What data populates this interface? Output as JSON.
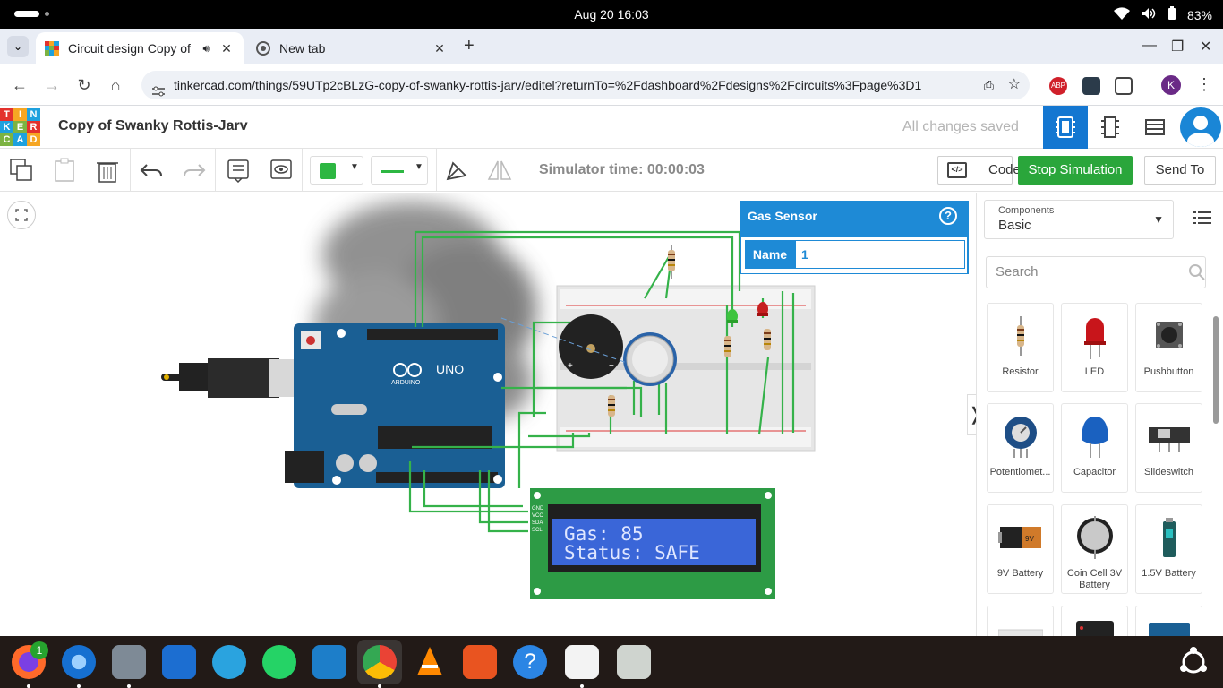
{
  "system": {
    "clock": "Aug 20  16:03",
    "battery": "83%"
  },
  "browser": {
    "tabs": [
      {
        "title": "Circuit design Copy of"
      },
      {
        "title": "New tab"
      }
    ],
    "url": "tinkercad.com/things/59UTp2cBLzG-copy-of-swanky-rottis-jarv/editel?returnTo=%2Fdashboard%2Fdesigns%2Fcircuits%3Fpage%3D1",
    "profile_initial": "K"
  },
  "app": {
    "logo_letters": [
      "T",
      "I",
      "N",
      "K",
      "E",
      "R",
      "C",
      "A",
      "D"
    ],
    "title": "Copy of Swanky Rottis-Jarv",
    "save_status": "All changes saved"
  },
  "toolbar": {
    "simulator_time": "Simulator time: 00:00:03",
    "code_label": "Code",
    "stop_label": "Stop Simulation",
    "send_label": "Send To",
    "color": "#2db742"
  },
  "inspector": {
    "title": "Gas Sensor",
    "help": "?",
    "name_label": "Name",
    "name_value": "1"
  },
  "circuit": {
    "arduino_label": "UNO",
    "arduino_brand": "ARDUINO",
    "lcd_line1": "Gas: 85",
    "lcd_line2": "Status: SAFE",
    "lcd_pins": [
      "GND",
      "VCC",
      "SDA",
      "SCL"
    ]
  },
  "components_panel": {
    "category_label": "Components",
    "category_value": "Basic",
    "search_placeholder": "Search",
    "items": [
      {
        "label": "Resistor",
        "icon": "resistor-icon"
      },
      {
        "label": "LED",
        "icon": "led-icon"
      },
      {
        "label": "Pushbutton",
        "icon": "pushbutton-icon"
      },
      {
        "label": "Potentiomet...",
        "icon": "potentiometer-icon"
      },
      {
        "label": "Capacitor",
        "icon": "capacitor-icon"
      },
      {
        "label": "Slideswitch",
        "icon": "slideswitch-icon"
      },
      {
        "label": "9V Battery",
        "icon": "battery-9v-icon"
      },
      {
        "label": "Coin Cell 3V Battery",
        "icon": "coin-cell-icon"
      },
      {
        "label": "1.5V Battery",
        "icon": "battery-1-5v-icon"
      }
    ]
  },
  "dock": {
    "firefox_badge": "1"
  }
}
